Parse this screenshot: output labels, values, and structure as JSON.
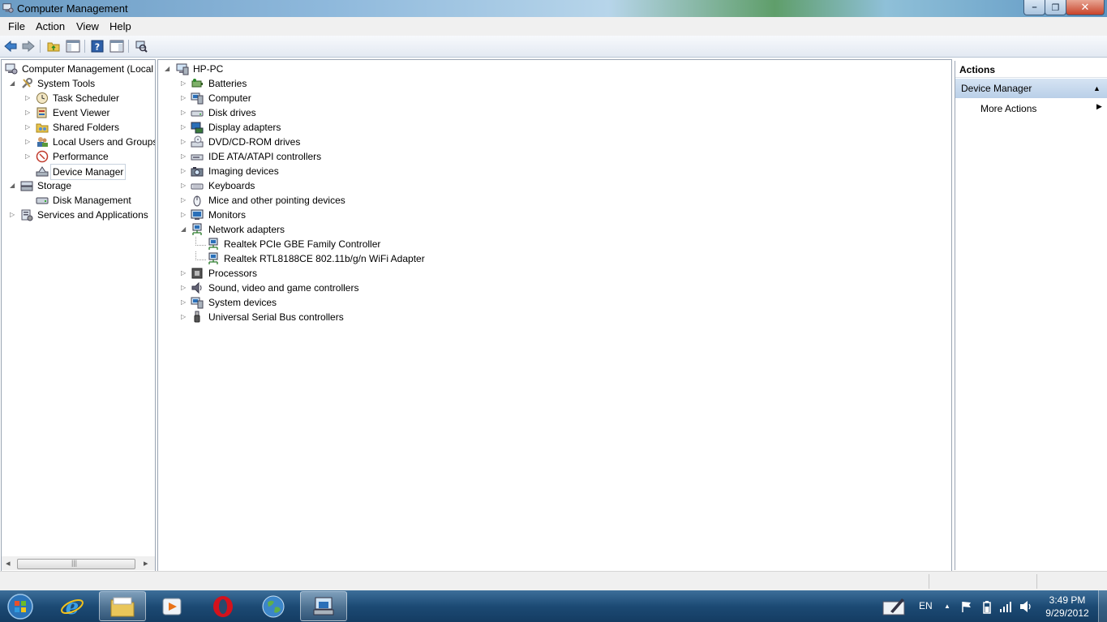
{
  "window": {
    "title": "Computer Management"
  },
  "window_controls": {
    "minimize": "–",
    "maximize": "❐",
    "close": "✕"
  },
  "menu": [
    "File",
    "Action",
    "View",
    "Help"
  ],
  "toolbar_icons": [
    "back-arrow-icon",
    "forward-arrow-icon",
    "up-folder-icon",
    "show-hide-tree-icon",
    "help-icon",
    "show-hide-action-pane-icon",
    "scan-hardware-icon"
  ],
  "left_tree": [
    {
      "label": "Computer Management (Local",
      "icon": "computer-management-icon",
      "expander": ""
    },
    {
      "label": "System Tools",
      "icon": "tools-icon",
      "expander": "◢"
    },
    {
      "label": "Task Scheduler",
      "icon": "clock-icon",
      "expander": "▷"
    },
    {
      "label": "Event Viewer",
      "icon": "event-viewer-icon",
      "expander": "▷"
    },
    {
      "label": "Shared Folders",
      "icon": "shared-folder-icon",
      "expander": "▷"
    },
    {
      "label": "Local Users and Groups",
      "icon": "users-icon",
      "expander": "▷"
    },
    {
      "label": "Performance",
      "icon": "performance-icon",
      "expander": "▷"
    },
    {
      "label": "Device Manager",
      "icon": "device-manager-icon",
      "expander": "",
      "selected": true
    },
    {
      "label": "Storage",
      "icon": "storage-icon",
      "expander": "◢"
    },
    {
      "label": "Disk Management",
      "icon": "disk-icon",
      "expander": ""
    },
    {
      "label": "Services and Applications",
      "icon": "services-icon",
      "expander": "▷"
    }
  ],
  "left_scroll": {
    "left_arrow": "◂",
    "right_arrow": "▸",
    "grip": "|||"
  },
  "device_tree": {
    "root": "HP-PC",
    "root_expander": "◢",
    "items": [
      {
        "label": "Batteries",
        "icon": "battery-icon",
        "expander": "▷"
      },
      {
        "label": "Computer",
        "icon": "computer-icon",
        "expander": "▷"
      },
      {
        "label": "Disk drives",
        "icon": "disk-drive-icon",
        "expander": "▷"
      },
      {
        "label": "Display adapters",
        "icon": "display-adapter-icon",
        "expander": "▷"
      },
      {
        "label": "DVD/CD-ROM drives",
        "icon": "dvd-icon",
        "expander": "▷"
      },
      {
        "label": "IDE ATA/ATAPI controllers",
        "icon": "ide-controller-icon",
        "expander": "▷"
      },
      {
        "label": "Imaging devices",
        "icon": "camera-icon",
        "expander": "▷"
      },
      {
        "label": "Keyboards",
        "icon": "keyboard-icon",
        "expander": "▷"
      },
      {
        "label": "Mice and other pointing devices",
        "icon": "mouse-icon",
        "expander": "▷"
      },
      {
        "label": "Monitors",
        "icon": "monitor-icon",
        "expander": "▷"
      },
      {
        "label": "Network adapters",
        "icon": "network-adapter-icon",
        "expander": "◢"
      },
      {
        "label": "Realtek PCIe GBE Family Controller",
        "icon": "network-adapter-icon",
        "expander": "",
        "child": true
      },
      {
        "label": "Realtek RTL8188CE 802.11b/g/n WiFi Adapter",
        "icon": "network-adapter-icon",
        "expander": "",
        "child": true
      },
      {
        "label": "Processors",
        "icon": "processor-icon",
        "expander": "▷"
      },
      {
        "label": "Sound, video and game controllers",
        "icon": "speaker-icon",
        "expander": "▷"
      },
      {
        "label": "System devices",
        "icon": "system-device-icon",
        "expander": "▷"
      },
      {
        "label": "Universal Serial Bus controllers",
        "icon": "usb-icon",
        "expander": "▷"
      }
    ]
  },
  "actions": {
    "title": "Actions",
    "section": "Device Manager",
    "section_arrow": "▲",
    "more": "More Actions",
    "more_arrow": "▶"
  },
  "taskbar": {
    "items": [
      "start-orb-icon",
      "internet-explorer-icon",
      "file-explorer-icon",
      "media-player-icon",
      "opera-icon",
      "globe-icon",
      "computer-management-icon"
    ],
    "lang": "EN",
    "time": "3:49 PM",
    "date": "9/29/2012",
    "tray_arrow": "▲"
  },
  "colors": {
    "selection": "#cde1f7",
    "accent": "#1c4a74"
  }
}
